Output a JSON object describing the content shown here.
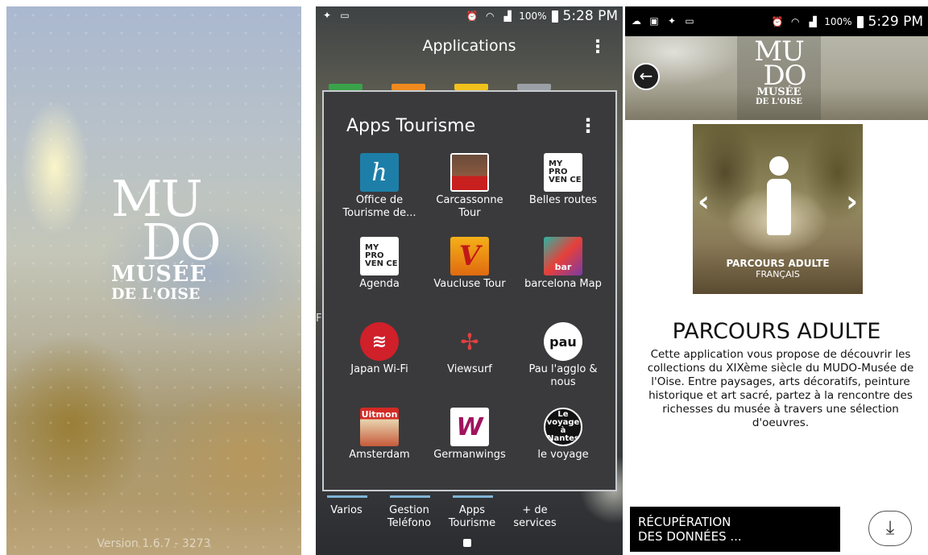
{
  "splash": {
    "logo_line1": "MU",
    "logo_line2": "DO",
    "logo_line3": "MUSÉE",
    "logo_line4": "DE L'OISE",
    "version": "Version 1.6.7 - 3273"
  },
  "launcher": {
    "status": {
      "battery": "100%",
      "time": "5:28 PM"
    },
    "header_title": "Applications",
    "side_peek_text": "F",
    "folder": {
      "title": "Apps Tourisme",
      "apps": [
        {
          "label": "Office de Tourisme de...",
          "icon": "office-tourisme-icon",
          "glyph": "h"
        },
        {
          "label": "Carcassonne Tour",
          "icon": "carcassonne-tour-icon",
          "glyph": "Tour"
        },
        {
          "label": "Belles routes",
          "icon": "belles-routes-icon",
          "glyph": "MY PRO VEN CE"
        },
        {
          "label": "Agenda",
          "icon": "agenda-icon",
          "glyph": "MY PRO VEN CE"
        },
        {
          "label": "Vaucluse Tour",
          "icon": "vaucluse-tour-icon",
          "glyph": "V"
        },
        {
          "label": "barcelona Map",
          "icon": "barcelona-map-icon",
          "glyph": "bar"
        },
        {
          "label": "Japan Wi-Fi",
          "icon": "japan-wifi-icon",
          "glyph": "≋"
        },
        {
          "label": "Viewsurf",
          "icon": "viewsurf-icon",
          "glyph": "✢"
        },
        {
          "label": "Pau l'agglo & nous",
          "icon": "pau-icon",
          "glyph": "pau"
        },
        {
          "label": "Amsterdam",
          "icon": "amsterdam-icon",
          "glyph": "Uitmon"
        },
        {
          "label": "Germanwings",
          "icon": "germanwings-icon",
          "glyph": "W"
        },
        {
          "label": "le voyage",
          "icon": "le-voyage-icon",
          "glyph": "Le voyage à Nantes"
        }
      ]
    },
    "dock": [
      {
        "label": "Varios"
      },
      {
        "label": "Gestion Teléfono"
      },
      {
        "label": "Apps Tourisme"
      },
      {
        "label": "+ de services"
      }
    ]
  },
  "detail": {
    "status": {
      "battery": "100%",
      "time": "5:29 PM"
    },
    "banner_logo": {
      "line1": "MU",
      "line2": "DO",
      "line3": "MUSÉE",
      "line4": "DE L'OISE"
    },
    "artwork_caption": "PARCOURS ADULTE",
    "artwork_language": "FRANÇAIS",
    "title": "PARCOURS ADULTE",
    "description": "Cette application vous propose de découvrir les collections du XIXème siècle du MUDO-Musée de l'Oise. Entre paysages, arts décoratifs, peinture historique et art sacré, partez à la rencontre des richesses du musée à travers une sélection d'oeuvres.",
    "download_label_line1": "RÉCUPÉRATION",
    "download_label_line2": "DES DONNÉES ..."
  }
}
